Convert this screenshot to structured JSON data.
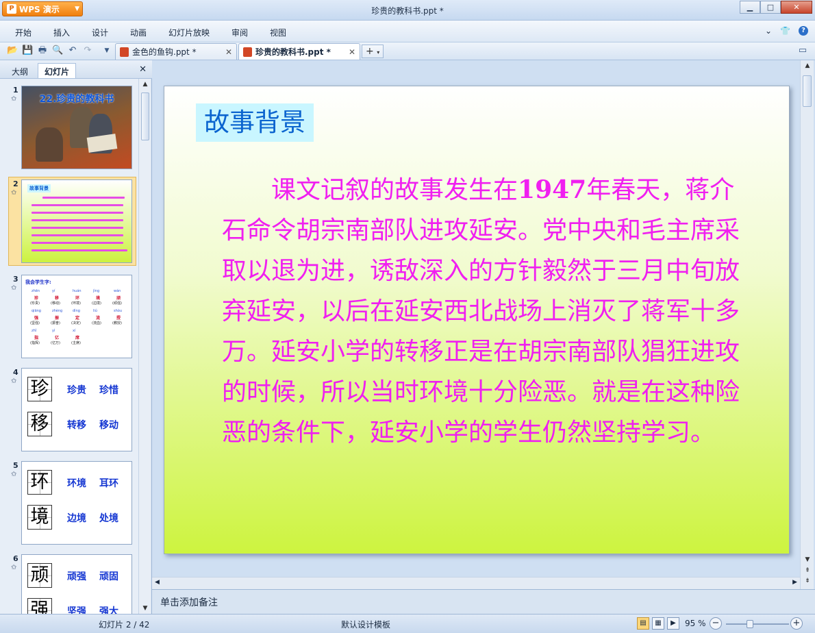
{
  "app": {
    "button_label": "WPS 演示",
    "window_title": "珍贵的教科书.ppt *"
  },
  "window_controls": {
    "minimize": "▁",
    "maximize": "□",
    "close": "✕"
  },
  "menu": [
    {
      "label": "开始"
    },
    {
      "label": "插入"
    },
    {
      "label": "设计"
    },
    {
      "label": "动画"
    },
    {
      "label": "幻灯片放映"
    },
    {
      "label": "审阅"
    },
    {
      "label": "视图"
    }
  ],
  "doc_tabs": [
    {
      "label": "金色的鱼钩.ppt *",
      "active": false
    },
    {
      "label": "珍贵的教科书.ppt *",
      "active": true
    }
  ],
  "left_panel": {
    "tabs": [
      {
        "label": "大纲"
      },
      {
        "label": "幻灯片"
      }
    ],
    "active_tab": "幻灯片",
    "thumbnails": [
      {
        "num": "1",
        "title": "22.珍贵的教科书"
      },
      {
        "num": "2",
        "heading": "故事背景"
      },
      {
        "num": "3",
        "title": "我会学生字:",
        "rows": [
          {
            "pinyin": [
              "zhēn",
              "yí",
              "huán",
              "jìng",
              "wán"
            ],
            "chars": [
              "珍",
              "移",
              "环",
              "境",
              "顽"
            ],
            "words": [
              "(珍贵)",
              "(移动)",
              "(环境)",
              "(边境)",
              "(顽强)"
            ]
          },
          {
            "pinyin": [
              "qiāng",
              "zhèng",
              "dìng",
              "liú",
              "shòu"
            ],
            "chars": [
              "强",
              "振",
              "定",
              "流",
              "授"
            ],
            "words": [
              "(坚强)",
              "(振奋)",
              "(决定)",
              "(流血)",
              "(教授)"
            ]
          },
          {
            "pinyin": [
              "zhǐ",
              "yì",
              "xí"
            ],
            "chars": [
              "指",
              "亿",
              "席"
            ],
            "words": [
              "(指挥)",
              "(亿万)",
              "(主席)"
            ]
          }
        ]
      },
      {
        "num": "4",
        "chars": [
          "珍",
          "移"
        ],
        "words": [
          [
            "珍贵",
            "珍惜"
          ],
          [
            "转移",
            "移动"
          ]
        ]
      },
      {
        "num": "5",
        "chars": [
          "环",
          "境"
        ],
        "words": [
          [
            "环境",
            "耳环"
          ],
          [
            "边境",
            "处境"
          ]
        ]
      },
      {
        "num": "6",
        "chars": [
          "顽",
          "强"
        ],
        "words": [
          [
            "顽强",
            "顽固"
          ],
          [
            "坚强",
            "强大"
          ]
        ]
      }
    ]
  },
  "slide": {
    "heading": "故事背景",
    "body_before_number": "　　课文记叙的故事发生在",
    "body_number": "1947",
    "body_after_number": "年春天，蒋介石命令胡宗南部队进攻延安。党中央和毛主席采取以退为进，诱敌深入的方针毅然于三月中旬放弃延安，以后在延安西北战场上消灭了蒋军十多万。延安小学的转移正是在胡宗南部队猖狂进攻的时候，所以当时环境十分险恶。就是在这种险恶的条件下，延安小学的学生仍然坚持学习。"
  },
  "notes": {
    "placeholder": "单击添加备注"
  },
  "status": {
    "slide_position": "幻灯片 2 / 42",
    "template": "默认设计模板",
    "zoom_label": "95 %",
    "zoom_level": 95
  },
  "colors": {
    "slide_text": "#f01ff0",
    "heading_text": "#0b64cf",
    "heading_bg": "#c9f6ff",
    "wps_orange": "#f07f0e"
  }
}
